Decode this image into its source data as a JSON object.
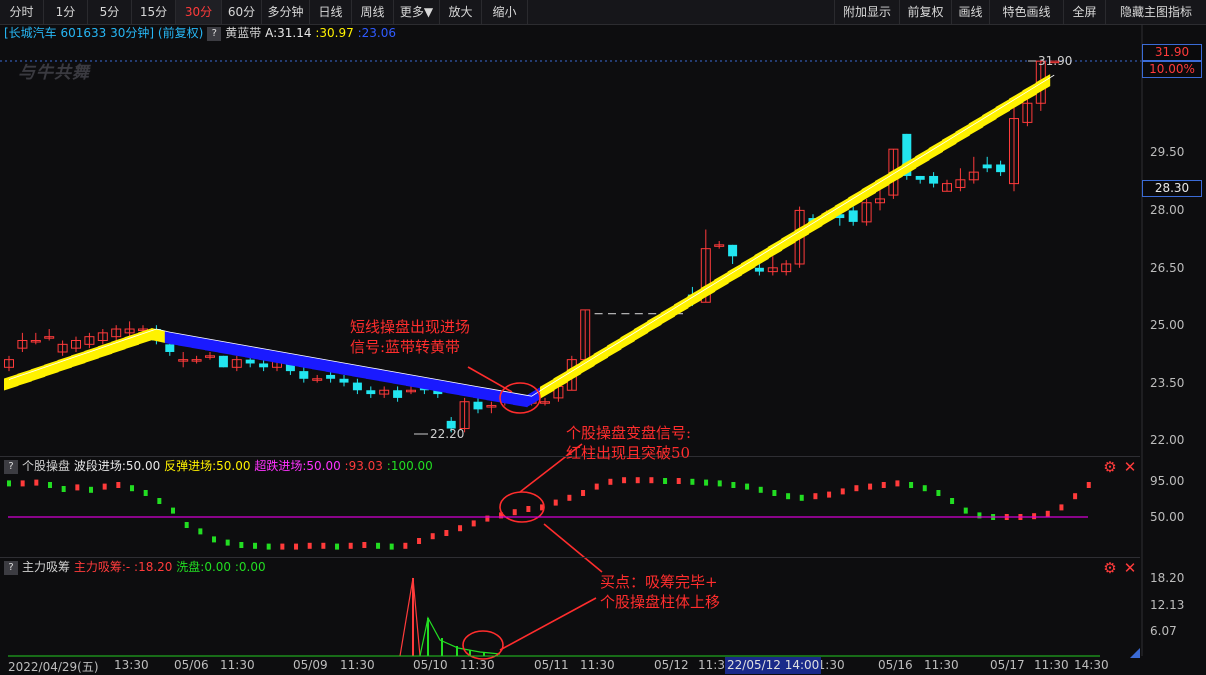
{
  "toolbar": {
    "left": [
      "分时",
      "1分",
      "5分",
      "15分",
      "30分",
      "60分",
      "多分钟",
      "日线",
      "周线",
      "更多▼",
      "放大",
      "缩小"
    ],
    "active": "30分",
    "right": [
      "附加显示",
      "前复权",
      "画线",
      "特色画线",
      "全屏",
      "隐藏主图指标"
    ]
  },
  "main": {
    "title": "[长城汽车 601633 30分钟] (前复权)",
    "help": "?",
    "indicator": "黄蓝带",
    "a_label": "A:31.14",
    "v2": ":30.97",
    "v3": ":23.06",
    "watermark": "与牛共舞",
    "price_axis": [
      "29.50",
      "28.00",
      "26.50",
      "25.00",
      "23.50",
      "22.00"
    ],
    "tag_high": "31.90",
    "tag_pct": "10.00%",
    "tag_mid": "28.30",
    "marker_high": "31.90",
    "marker_low": "22.20"
  },
  "sub1": {
    "help": "?",
    "name": "个股操盘",
    "l1": "波段进场:50.00",
    "l2": "反弹进场:50.00",
    "l3": "超跌进场:50.00",
    "l4": ":93.03",
    "l5": ":100.00",
    "axis": [
      "95.00",
      "50.00"
    ]
  },
  "sub2": {
    "help": "?",
    "name": "主力吸筹",
    "l1": "主力吸筹:-",
    "l2": ":18.20",
    "l3": "洗盘:0.00",
    "l4": ":0.00",
    "axis": [
      "18.20",
      "12.13",
      "6.07"
    ]
  },
  "annotations": {
    "a1_line1": "短线操盘出现进场",
    "a1_line2": "信号:蓝带转黄带",
    "a2_line1": "个股操盘变盘信号:",
    "a2_line2": "红柱出现且突破50",
    "a3_line1": "买点：吸筹完毕+",
    "a3_line2": "个股操盘柱体上移"
  },
  "time_axis": [
    "2022/04/29(五)",
    "13:30",
    "05/06",
    "11:30",
    "05/09",
    "11:30",
    "05/10",
    "11:30",
    "05/11",
    "11:30",
    "05/12",
    "11:30",
    "05/16",
    "11:30",
    "05/17",
    "11:30",
    "14:30"
  ],
  "cursor_date": "22/05/12 14:00",
  "colors": {
    "up": "#ff3b3b",
    "down": "#22e5f0",
    "yellow": "#fff200",
    "blue": "#1a1aff",
    "green": "#22dd22",
    "magenta": "#ff00ff",
    "bg": "#0d0d0f"
  },
  "icons": {
    "settings": "gear-icon",
    "close": "close-icon"
  }
}
